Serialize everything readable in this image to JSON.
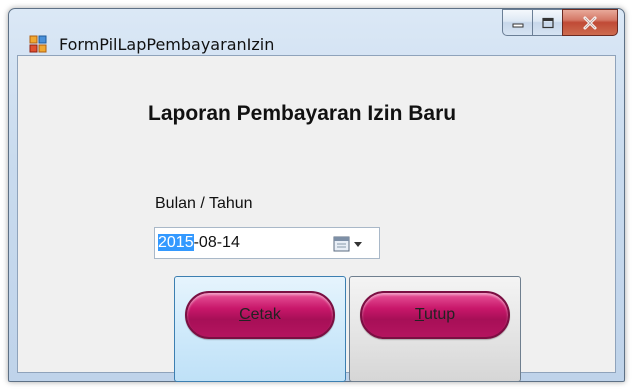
{
  "window": {
    "title": "FormPilLapPembayaranIzin",
    "icon": "windows-form-icon",
    "controls": {
      "minimize_icon": "minimize-icon",
      "maximize_icon": "maximize-icon",
      "close_icon": "close-icon"
    }
  },
  "form": {
    "heading": "Laporan Pembayaran Izin Baru",
    "period_label": "Bulan / Tahun",
    "date_picker": {
      "value_year": "2015",
      "value_rest": "-08-14",
      "icon": "calendar-dropdown-icon"
    },
    "buttons": {
      "print": {
        "mnemonic": "C",
        "rest": "etak"
      },
      "close": {
        "mnemonic": "T",
        "rest": "utup"
      }
    }
  },
  "colors": {
    "button_accent": "#c8176a",
    "selection": "#3399ff",
    "close_button": "#c04a36"
  }
}
